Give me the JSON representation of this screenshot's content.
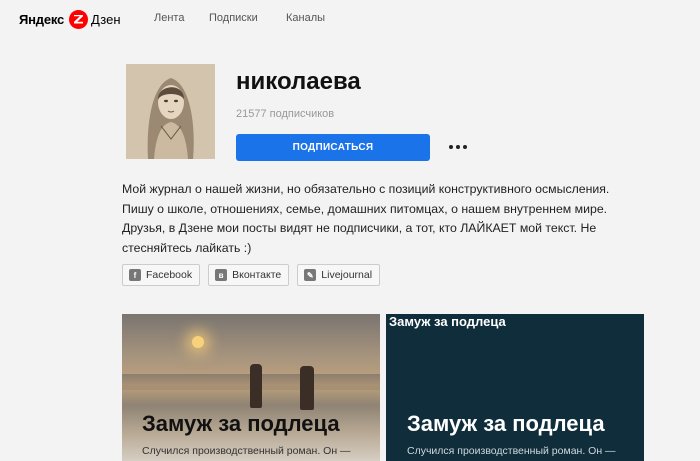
{
  "logo": {
    "yandex": "Яндекс",
    "dzen": "Дзен"
  },
  "nav": [
    {
      "label": "Лента"
    },
    {
      "label": "Подписки"
    },
    {
      "label": "Каналы"
    }
  ],
  "profile": {
    "name": "николаева",
    "subscribers": "21577 подписчиков",
    "subscribe_label": "ПОДПИСАТЬСЯ",
    "description_lines": [
      "Мой журнал о нашей жизни, но обязательно с позиций конструктивного осмысления.",
      "Пишу о школе, отношениях, семье, домашних питомцах, о нашем внутреннем мире.",
      "Друзья, в Дзене мои посты видят не подписчики, а тот, кто ЛАЙКАЕТ мой текст. Не",
      "стесняйтесь лайкать :)"
    ]
  },
  "socials": [
    {
      "label": "Facebook",
      "icon": "facebook-icon"
    },
    {
      "label": "Вконтакте",
      "icon": "vk-icon"
    },
    {
      "label": "Livejournal",
      "icon": "livejournal-icon"
    }
  ],
  "cards": [
    {
      "title": "Замуж за подлеца",
      "subtitle": "Случился производственный роман. Он —"
    },
    {
      "top_label": "Замуж за подлеца",
      "title": "Замуж за подлеца",
      "subtitle": "Случился производственный роман. Он —"
    }
  ],
  "colors": {
    "accent": "#1a73e8",
    "brand_red": "#ff0000",
    "background": "#f3f3f3",
    "card_dark": "#0f2d3b"
  }
}
